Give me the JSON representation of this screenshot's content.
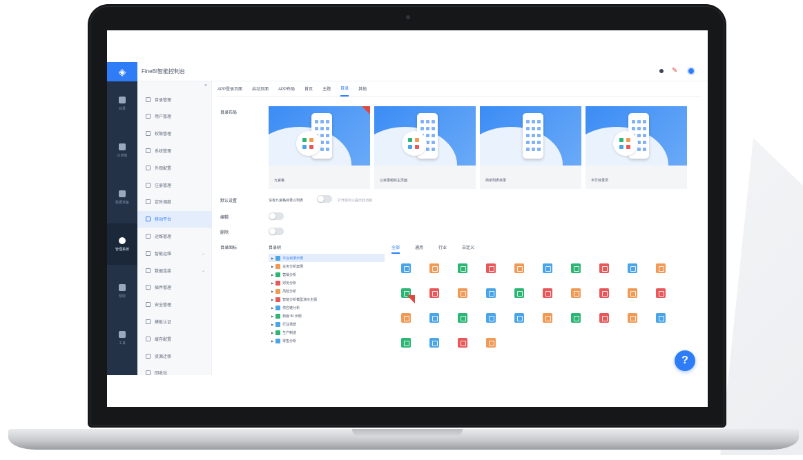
{
  "app": {
    "title": "FineBI智能控制台"
  },
  "rail": {
    "items": [
      {
        "label": "目录",
        "active": false
      },
      {
        "label": "仪表板",
        "active": false
      },
      {
        "label": "数据准备",
        "active": false
      },
      {
        "label": "管理系统",
        "active": true
      },
      {
        "label": "帮助",
        "active": false
      },
      {
        "label": "工具",
        "active": false
      }
    ]
  },
  "sidebar": {
    "collapse": "≡",
    "items": [
      {
        "label": "目录管理",
        "active": false
      },
      {
        "label": "用户管理",
        "active": false
      },
      {
        "label": "权限管理",
        "active": false
      },
      {
        "label": "系统管理",
        "active": false
      },
      {
        "label": "外观配置",
        "active": false
      },
      {
        "label": "注册管理",
        "active": false
      },
      {
        "label": "定时调度",
        "active": false
      },
      {
        "label": "移动平台",
        "active": true
      },
      {
        "label": "运维管理",
        "active": false
      },
      {
        "label": "智能运维",
        "active": false,
        "chevron": "⌄"
      },
      {
        "label": "数据连接",
        "active": false,
        "chevron": "⌄"
      },
      {
        "label": "插件管理",
        "active": false
      },
      {
        "label": "安全管理",
        "active": false
      },
      {
        "label": "模板认证",
        "active": false
      },
      {
        "label": "缓存配置",
        "active": false
      },
      {
        "label": "资源迁移",
        "active": false
      },
      {
        "label": "回收站",
        "active": false
      }
    ]
  },
  "tabs": [
    {
      "label": "APP登录页面",
      "active": false
    },
    {
      "label": "启动页面",
      "active": false
    },
    {
      "label": "APP布局",
      "active": false
    },
    {
      "label": "首页",
      "active": false
    },
    {
      "label": "主题",
      "active": false
    },
    {
      "label": "目录",
      "active": true
    },
    {
      "label": "其他",
      "active": false
    }
  ],
  "section": {
    "layout_label": "目录布局",
    "cards": [
      {
        "caption": "九宫格",
        "selected": true
      },
      {
        "caption": "以目录组织主页面",
        "selected": false
      },
      {
        "caption": "简单列表目录",
        "selected": false
      },
      {
        "caption": "平行目录页",
        "selected": false
      }
    ],
    "default_label": "默认设置",
    "default_option": "没有九宫格目录以列表",
    "default_hint": "打开后可以提示此功能",
    "edit_label": "编辑",
    "delete_label": "删除",
    "icon_label": "目录图标",
    "tree_head": "目录树",
    "tree_items": [
      {
        "label": "平台目录示例",
        "color": "#4aa5e8",
        "active": true
      },
      {
        "label": "业务分析案例",
        "color": "#f19a56",
        "active": false
      },
      {
        "label": "营销分析",
        "color": "#2bb673",
        "active": false
      },
      {
        "label": "财务分析",
        "color": "#e8585a",
        "active": false
      },
      {
        "label": "风险分析",
        "color": "#f19a56",
        "active": false
      },
      {
        "label": "智能分析模型演示主题",
        "color": "#e8585a",
        "active": false
      },
      {
        "label": "供应链分析",
        "color": "#4aa5e8",
        "active": false
      },
      {
        "label": "新版 BI 示例",
        "color": "#2bb673",
        "active": false
      },
      {
        "label": "行业场景",
        "color": "#4aa5e8",
        "active": false
      },
      {
        "label": "生产制造",
        "color": "#2bb673",
        "active": false
      },
      {
        "label": "零售分析",
        "color": "#4aa5e8",
        "active": false
      }
    ],
    "icon_tabs": [
      {
        "label": "全部",
        "active": true
      },
      {
        "label": "通用",
        "active": false
      },
      {
        "label": "行业",
        "active": false
      },
      {
        "label": "自定义",
        "active": false
      }
    ],
    "icon_grid_colors": [
      "#4aa5e8",
      "#f19a56",
      "#2bb673",
      "#e8585a",
      "#f19a56",
      "#4aa5e8",
      "#2bb673",
      "#e8585a",
      "#4aa5e8",
      "#f19a56",
      "#2bb673",
      "#e8585a",
      "#f19a56",
      "#4aa5e8",
      "#2bb673",
      "#e8585a",
      "#f19a56",
      "#e8585a",
      "#f19a56",
      "#e8585a",
      "#f19a56",
      "#4aa5e8",
      "#2bb673",
      "#4aa5e8",
      "#4aa5e8",
      "#f19a56",
      "#2bb673",
      "#e8585a",
      "#f19a56",
      "#4aa5e8",
      "#2bb673",
      "#4aa5e8",
      "#e8585a",
      "#f19a56"
    ]
  },
  "help": {
    "label": "?"
  },
  "colors": {
    "accent": "#2f7df6",
    "rail": "#233247",
    "badge": "#e0483f"
  }
}
